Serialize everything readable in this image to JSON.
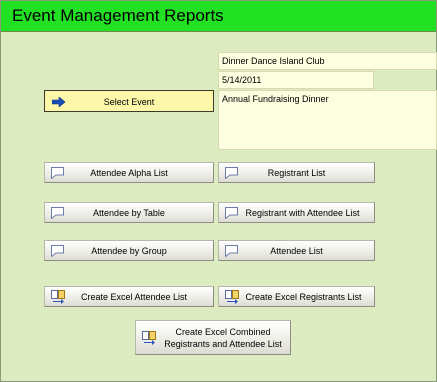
{
  "header": {
    "title": "Event Management Reports"
  },
  "event": {
    "club_name": "Dinner Dance Island Club",
    "date": "5/14/2011",
    "description": "Annual Fundraising Dinner"
  },
  "buttons": {
    "select_event": "Select Event",
    "attendee_alpha_list": "Attendee Alpha List",
    "registrant_list": "Registrant List",
    "attendee_by_table": "Attendee by Table",
    "registrant_with_attendee_list": "Registrant with Attendee List",
    "attendee_by_group": "Attendee by Group",
    "attendee_list": "Attendee List",
    "create_excel_attendee_list": "Create Excel Attendee List",
    "create_excel_registrants_list": "Create Excel Registrants List",
    "create_excel_combined_line1": "Create Excel Combined",
    "create_excel_combined_line2": "Registrants and Attendee List"
  },
  "icons": {
    "arrow": "arrow-right-icon",
    "report": "report-icon",
    "excel": "excel-export-icon"
  },
  "colors": {
    "header": "#22e022",
    "background": "#dcebc0",
    "select_button": "#fcf6a8",
    "info_field": "#fdfde0"
  }
}
